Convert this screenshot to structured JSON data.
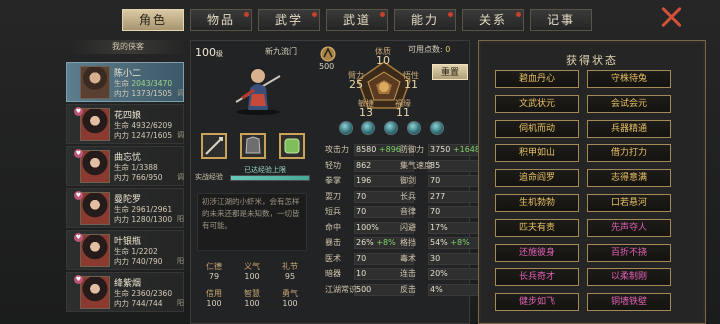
{
  "tabs": [
    {
      "label": "角色",
      "active": true,
      "dot": false
    },
    {
      "label": "物品",
      "dot": true
    },
    {
      "label": "武学",
      "dot": true
    },
    {
      "label": "武道",
      "dot": true
    },
    {
      "label": "能力",
      "dot": true
    },
    {
      "label": "关系",
      "dot": true
    },
    {
      "label": "记事",
      "dot": false
    }
  ],
  "companions_header": "我的侠客",
  "companions": [
    {
      "name": "陈小二",
      "hp_label": "生命",
      "hp": "2043/3470",
      "mp_label": "内力",
      "mp": "1373/1505",
      "tag": "调"
    },
    {
      "name": "花四娘",
      "hp_label": "生命",
      "hp": "4932/6209",
      "mp_label": "内力",
      "mp": "1247/1605",
      "tag": "调"
    },
    {
      "name": "曲忘忧",
      "hp_label": "生命",
      "hp": "1/3388",
      "mp_label": "内力",
      "mp": "766/950",
      "tag": "调"
    },
    {
      "name": "曼陀罗",
      "hp_label": "生命",
      "hp": "2961/2961",
      "mp_label": "内力",
      "mp": "1280/1300",
      "tag": "阳"
    },
    {
      "name": "叶银瓶",
      "hp_label": "生命",
      "hp": "1/2202",
      "mp_label": "内力",
      "mp": "740/790",
      "tag": "阳"
    },
    {
      "name": "绛紫烟",
      "hp_label": "生命",
      "hp": "2360/2360",
      "mp_label": "内力",
      "mp": "744/744",
      "tag": "阳"
    }
  ],
  "side_labels": [
    "阳",
    "调"
  ],
  "hero": {
    "level": "100",
    "level_unit": "级",
    "school": "新九流门",
    "potential": "500",
    "available_points_label": "可用点数:",
    "available_points": "0",
    "reset_label": "重置"
  },
  "attributes": [
    {
      "label": "体质",
      "value": "10"
    },
    {
      "label": "臂力",
      "value": "25"
    },
    {
      "label": "悟性",
      "value": "11"
    },
    {
      "label": "敏捷",
      "value": "13"
    },
    {
      "label": "福缘",
      "value": "11"
    }
  ],
  "exp": {
    "label": "实战经验",
    "status": "已达经验上限",
    "progress": 1.0
  },
  "bio": "初涉江湖的小虾米，会有怎样的未来还都是未知数，一切皆有可能。",
  "virtues": [
    {
      "label": "仁德",
      "value": "79"
    },
    {
      "label": "义气",
      "value": "100"
    },
    {
      "label": "礼节",
      "value": "95"
    },
    {
      "label": "信用",
      "value": "100"
    },
    {
      "label": "智慧",
      "value": "100"
    },
    {
      "label": "勇气",
      "value": "100"
    }
  ],
  "stats_left": [
    {
      "label": "攻击力",
      "value": "8580",
      "bonus": "+896"
    },
    {
      "label": "轻功",
      "value": "862",
      "bonus": ""
    },
    {
      "label": "拳掌",
      "value": "196",
      "bonus": ""
    },
    {
      "label": "耍刀",
      "value": "70",
      "bonus": ""
    },
    {
      "label": "短兵",
      "value": "70",
      "bonus": ""
    },
    {
      "label": "命中",
      "value": "100%",
      "bonus": ""
    },
    {
      "label": "暴击",
      "value": "26%",
      "bonus": "+8%"
    },
    {
      "label": "医术",
      "value": "70",
      "bonus": ""
    },
    {
      "label": "暗器",
      "value": "10",
      "bonus": ""
    },
    {
      "label": "江湖常识",
      "value": "500",
      "bonus": ""
    }
  ],
  "stats_right": [
    {
      "label": "防御力",
      "value": "3750",
      "bonus": "+1648"
    },
    {
      "label": "集气速度",
      "value": "85",
      "bonus": ""
    },
    {
      "label": "御剑",
      "value": "70",
      "bonus": ""
    },
    {
      "label": "长兵",
      "value": "277",
      "bonus": ""
    },
    {
      "label": "音律",
      "value": "70",
      "bonus": ""
    },
    {
      "label": "闪避",
      "value": "17%",
      "bonus": ""
    },
    {
      "label": "格挡",
      "value": "54%",
      "bonus": "+8%"
    },
    {
      "label": "毒术",
      "value": "30",
      "bonus": ""
    },
    {
      "label": "连击",
      "value": "20%",
      "bonus": ""
    },
    {
      "label": "反击",
      "value": "4%",
      "bonus": ""
    }
  ],
  "status_title": "获得状态",
  "status_effects": [
    {
      "label": "碧血丹心",
      "color": "#e8c264"
    },
    {
      "label": "守株待兔",
      "color": "#e8c264"
    },
    {
      "label": "文武状元",
      "color": "#e8c264"
    },
    {
      "label": "会试会元",
      "color": "#e8c264"
    },
    {
      "label": "伺机而动",
      "color": "#e8c264"
    },
    {
      "label": "兵器精通",
      "color": "#e8c264"
    },
    {
      "label": "积甲如山",
      "color": "#e8c264"
    },
    {
      "label": "借力打力",
      "color": "#e8c264"
    },
    {
      "label": "追命阎罗",
      "color": "#e8c264"
    },
    {
      "label": "志得意满",
      "color": "#e8c264"
    },
    {
      "label": "生机勃勃",
      "color": "#e8c264"
    },
    {
      "label": "口若悬河",
      "color": "#e8c264"
    },
    {
      "label": "匹夫有责",
      "color": "#e8c264"
    },
    {
      "label": "先声夺人",
      "color": "#e060b8"
    },
    {
      "label": "还施彼身",
      "color": "#e060b8"
    },
    {
      "label": "百折不挠",
      "color": "#e060b8"
    },
    {
      "label": "长兵奇才",
      "color": "#e060b8"
    },
    {
      "label": "以柔制刚",
      "color": "#e060b8"
    },
    {
      "label": "健步如飞",
      "color": "#e060b8"
    },
    {
      "label": "铜墙铁壁",
      "color": "#e060b8"
    }
  ]
}
